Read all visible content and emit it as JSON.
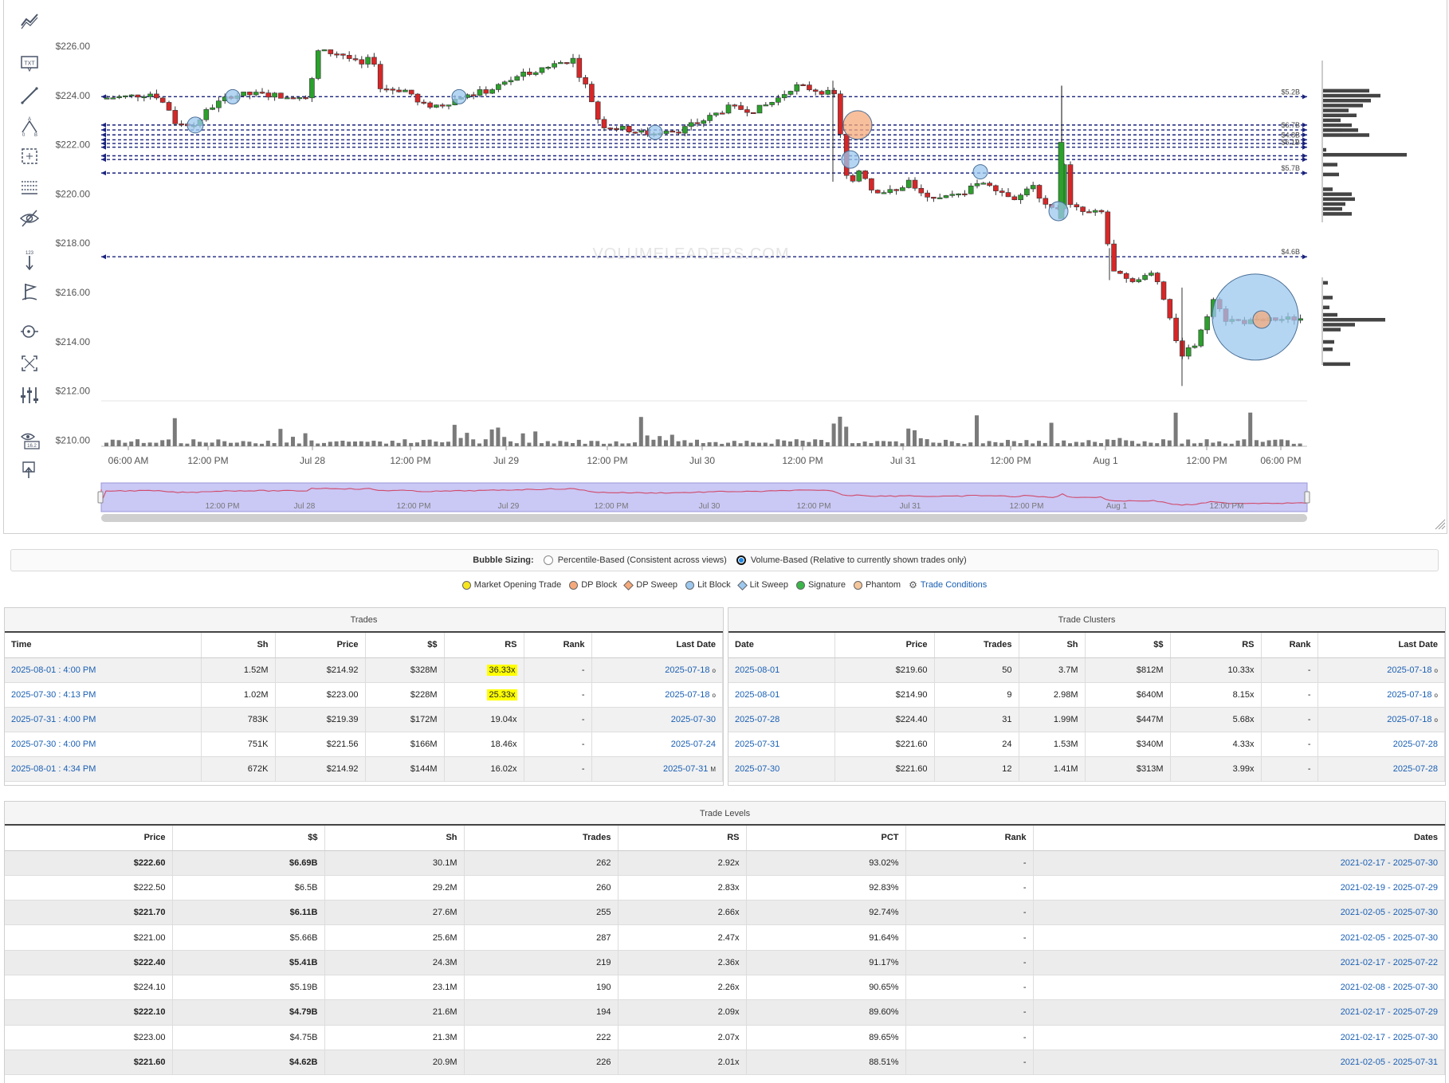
{
  "chart": {
    "watermark": "VOLUMELEADERS.COM",
    "price_axis": {
      "min": 210,
      "max": 227,
      "labels": [
        {
          "value": 226,
          "text": "$226.00"
        },
        {
          "value": 224,
          "text": "$224.00"
        },
        {
          "value": 222,
          "text": "$222.00"
        },
        {
          "value": 220,
          "text": "$220.00"
        },
        {
          "value": 218,
          "text": "$218.00"
        },
        {
          "value": 216,
          "text": "$216.00"
        },
        {
          "value": 214,
          "text": "$214.00"
        },
        {
          "value": 212,
          "text": "$212.00"
        },
        {
          "value": 210,
          "text": "$210.00"
        }
      ]
    },
    "time_axis": [
      "06:00 AM",
      "12:00 PM",
      "Jul 28",
      "12:00 PM",
      "Jul 29",
      "12:00 PM",
      "Jul 30",
      "12:00 PM",
      "Jul 31",
      "12:00 PM",
      "Aug 1",
      "12:00 PM",
      "06:00 PM"
    ],
    "navigator_labels": [
      "12:00 PM",
      "Jul 28",
      "12:00 PM",
      "Jul 29",
      "12:00 PM",
      "Jul 30",
      "12:00 PM",
      "Jul 31",
      "12:00 PM",
      "Aug 1",
      "12:00 PM"
    ],
    "level_lines": [
      {
        "price": 223.95,
        "label": "$5.2B"
      },
      {
        "price": 222.8,
        "label": ""
      },
      {
        "price": 222.6,
        "label": "$6.7B"
      },
      {
        "price": 222.4,
        "label": ""
      },
      {
        "price": 222.2,
        "label": "$4.8B"
      },
      {
        "price": 222.05,
        "label": ""
      },
      {
        "price": 221.9,
        "label": "$6.1B"
      },
      {
        "price": 221.55,
        "label": ""
      },
      {
        "price": 221.4,
        "label": ""
      },
      {
        "price": 220.85,
        "label": "$5.7B"
      },
      {
        "price": 217.45,
        "label": "$4.6B"
      }
    ],
    "colors": {
      "up": "#2ca02c",
      "down": "#d62728",
      "level": "#1a237e",
      "lit_block": "#9cc8ef",
      "dp_block": "#f5a97b",
      "volume": "#7a7a7a"
    }
  },
  "toolbar": [
    "trend-icon",
    "text-icon",
    "line-icon",
    "fib-icon",
    "rect-select-icon",
    "hlines-icon",
    "hide-icon",
    "measure-icon",
    "flag-icon",
    "zoom-target-icon",
    "fullscreen-icon",
    "adjust-icon",
    "eye-price-icon",
    "export-icon"
  ],
  "bubble_sizing": {
    "title": "Bubble Sizing:",
    "option1": "Percentile-Based (Consistent across views)",
    "option2": "Volume-Based (Relative to currently shown trades only)",
    "selected": "option2"
  },
  "legend": {
    "items": [
      {
        "label": "Market Opening Trade",
        "color": "#f7e51e",
        "shape": "circle"
      },
      {
        "label": "DP Block",
        "color": "#f5a97b",
        "shape": "circle"
      },
      {
        "label": "DP Sweep",
        "color": "#f5a97b",
        "shape": "diamond"
      },
      {
        "label": "Lit Block",
        "color": "#9cc8ef",
        "shape": "circle"
      },
      {
        "label": "Lit Sweep",
        "color": "#9cc8ef",
        "shape": "diamond"
      },
      {
        "label": "Signature",
        "color": "#3bb54a",
        "shape": "circle"
      },
      {
        "label": "Phantom",
        "color": "#f5c69b",
        "shape": "circle"
      }
    ],
    "conditions_label": "Trade Conditions"
  },
  "trades": {
    "title": "Trades",
    "headers": [
      "Time",
      "Sh",
      "Price",
      "$$",
      "RS",
      "Rank",
      "Last Date"
    ],
    "rows": [
      {
        "time": "2025-08-01 : 4:00 PM",
        "sh": "1.52M",
        "price": "$214.92",
        "dollars": "$328M",
        "rs": "36.33x",
        "rs_hl": true,
        "rank": "-",
        "last": "2025-07-18",
        "suffix": "o"
      },
      {
        "time": "2025-07-30 : 4:13 PM",
        "sh": "1.02M",
        "price": "$223.00",
        "dollars": "$228M",
        "rs": "25.33x",
        "rs_hl": true,
        "rank": "-",
        "last": "2025-07-18",
        "suffix": "o"
      },
      {
        "time": "2025-07-31 : 4:00 PM",
        "sh": "783K",
        "price": "$219.39",
        "dollars": "$172M",
        "rs": "19.04x",
        "rs_hl": false,
        "rank": "-",
        "last": "2025-07-30",
        "suffix": ""
      },
      {
        "time": "2025-07-30 : 4:00 PM",
        "sh": "751K",
        "price": "$221.56",
        "dollars": "$166M",
        "rs": "18.46x",
        "rs_hl": false,
        "rank": "-",
        "last": "2025-07-24",
        "suffix": ""
      },
      {
        "time": "2025-08-01 : 4:34 PM",
        "sh": "672K",
        "price": "$214.92",
        "dollars": "$144M",
        "rs": "16.02x",
        "rs_hl": false,
        "rank": "-",
        "last": "2025-07-31",
        "suffix": "M"
      }
    ]
  },
  "clusters": {
    "title": "Trade Clusters",
    "headers": [
      "Date",
      "Price",
      "Trades",
      "Sh",
      "$$",
      "RS",
      "Rank",
      "Last Date"
    ],
    "rows": [
      {
        "date": "2025-08-01",
        "price": "$219.60",
        "trades": "50",
        "sh": "3.7M",
        "dollars": "$812M",
        "rs": "10.33x",
        "rank": "-",
        "last": "2025-07-18",
        "suffix": "o"
      },
      {
        "date": "2025-08-01",
        "price": "$214.90",
        "trades": "9",
        "sh": "2.98M",
        "dollars": "$640M",
        "rs": "8.15x",
        "rank": "-",
        "last": "2025-07-18",
        "suffix": "o"
      },
      {
        "date": "2025-07-28",
        "price": "$224.40",
        "trades": "31",
        "sh": "1.99M",
        "dollars": "$447M",
        "rs": "5.68x",
        "rank": "-",
        "last": "2025-07-18",
        "suffix": "o"
      },
      {
        "date": "2025-07-31",
        "price": "$221.60",
        "trades": "24",
        "sh": "1.53M",
        "dollars": "$340M",
        "rs": "4.33x",
        "rank": "-",
        "last": "2025-07-28",
        "suffix": ""
      },
      {
        "date": "2025-07-30",
        "price": "$221.60",
        "trades": "12",
        "sh": "1.41M",
        "dollars": "$313M",
        "rs": "3.99x",
        "rank": "-",
        "last": "2025-07-28",
        "suffix": ""
      }
    ]
  },
  "levels": {
    "title": "Trade Levels",
    "headers": [
      "Price",
      "$$",
      "Sh",
      "Trades",
      "RS",
      "PCT",
      "Rank",
      "Dates"
    ],
    "rows": [
      {
        "price": "$222.60",
        "dollars": "$6.69B",
        "sh": "30.1M",
        "trades": "262",
        "rs": "2.92x",
        "pct": "93.02%",
        "rank": "-",
        "dates": "2021-02-17 - 2025-07-30"
      },
      {
        "price": "$222.50",
        "dollars": "$6.5B",
        "sh": "29.2M",
        "trades": "260",
        "rs": "2.83x",
        "pct": "92.83%",
        "rank": "-",
        "dates": "2021-02-19 - 2025-07-29"
      },
      {
        "price": "$221.70",
        "dollars": "$6.11B",
        "sh": "27.6M",
        "trades": "255",
        "rs": "2.66x",
        "pct": "92.74%",
        "rank": "-",
        "dates": "2021-02-05 - 2025-07-30"
      },
      {
        "price": "$221.00",
        "dollars": "$5.66B",
        "sh": "25.6M",
        "trades": "287",
        "rs": "2.47x",
        "pct": "91.64%",
        "rank": "-",
        "dates": "2021-02-05 - 2025-07-30"
      },
      {
        "price": "$222.40",
        "dollars": "$5.41B",
        "sh": "24.3M",
        "trades": "219",
        "rs": "2.36x",
        "pct": "91.17%",
        "rank": "-",
        "dates": "2021-02-17 - 2025-07-22"
      },
      {
        "price": "$224.10",
        "dollars": "$5.19B",
        "sh": "23.1M",
        "trades": "190",
        "rs": "2.26x",
        "pct": "90.65%",
        "rank": "-",
        "dates": "2021-02-08 - 2025-07-30"
      },
      {
        "price": "$222.10",
        "dollars": "$4.79B",
        "sh": "21.6M",
        "trades": "194",
        "rs": "2.09x",
        "pct": "89.60%",
        "rank": "-",
        "dates": "2021-02-17 - 2025-07-29"
      },
      {
        "price": "$223.00",
        "dollars": "$4.75B",
        "sh": "21.3M",
        "trades": "222",
        "rs": "2.07x",
        "pct": "89.65%",
        "rank": "-",
        "dates": "2021-02-17 - 2025-07-30"
      },
      {
        "price": "$221.60",
        "dollars": "$4.62B",
        "sh": "20.9M",
        "trades": "226",
        "rs": "2.01x",
        "pct": "88.51%",
        "rank": "-",
        "dates": "2021-02-05 - 2025-07-31"
      }
    ]
  }
}
